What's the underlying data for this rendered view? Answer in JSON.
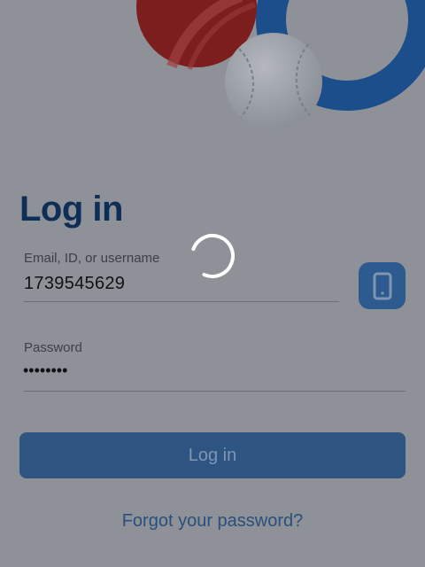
{
  "page": {
    "title": "Log in"
  },
  "email_field": {
    "label": "Email, ID, or username",
    "value": "1739545629"
  },
  "password_field": {
    "label": "Password",
    "value": "••••••••"
  },
  "phone_button": {
    "icon": "smartphone-icon"
  },
  "login_button": {
    "label": "Log in"
  },
  "forgot_link": {
    "label": "Forgot your password?"
  },
  "loading": {
    "icon": "loading-spinner-icon"
  },
  "hero": {
    "icons": [
      "cricket-ball-icon",
      "baseball-icon",
      "logo-ring-icon"
    ]
  },
  "colors": {
    "overlay_background": "#8e9298",
    "title": "#0e2e55",
    "primary_button": "#2e5481",
    "link": "#2a4f7b",
    "cricket_ball": "#7c1e1e",
    "ring": "#1b4e8a"
  }
}
